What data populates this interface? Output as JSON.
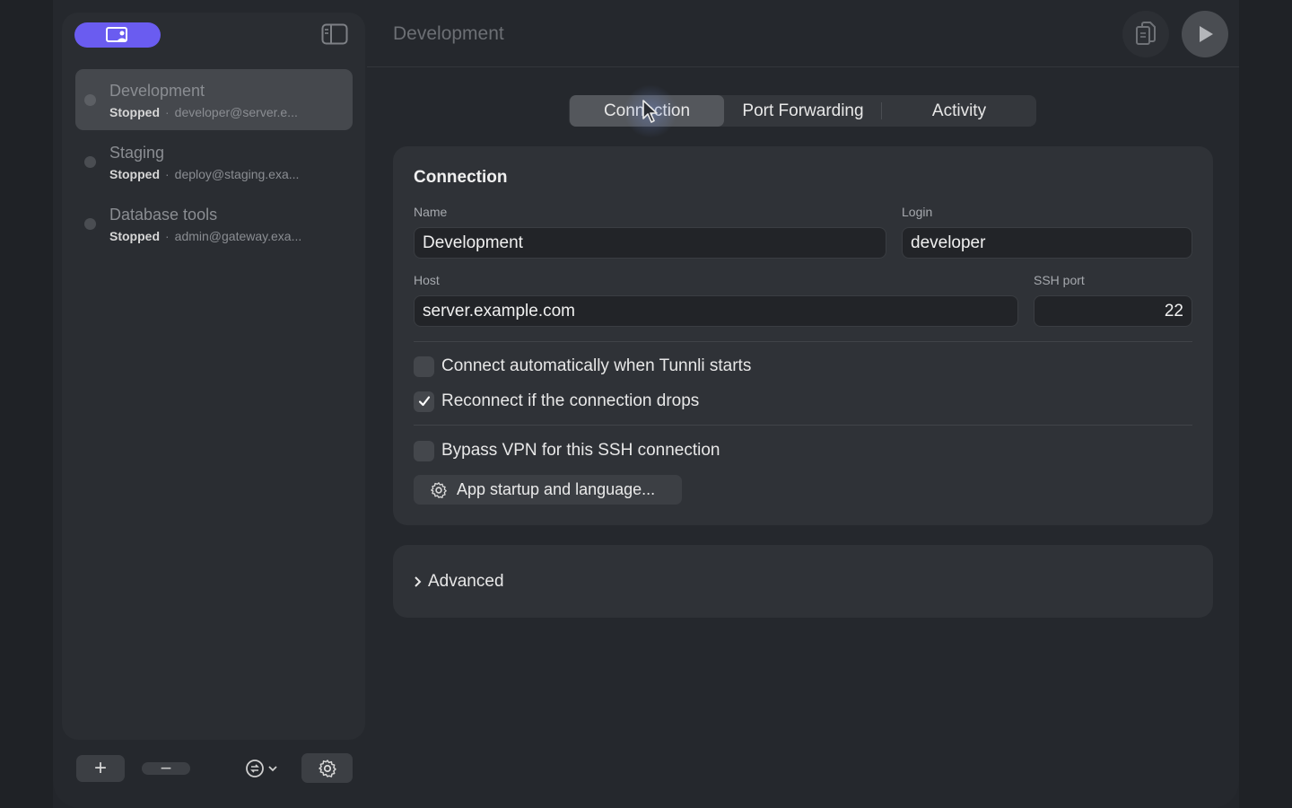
{
  "window": {
    "title": "Development"
  },
  "sidebar": {
    "items": [
      {
        "name": "Development",
        "status": "Stopped",
        "detail": "developer@server.e...",
        "selected": true
      },
      {
        "name": "Staging",
        "status": "Stopped",
        "detail": "deploy@staging.exa...",
        "selected": false
      },
      {
        "name": "Database tools",
        "status": "Stopped",
        "detail": "admin@gateway.exa...",
        "selected": false
      }
    ],
    "separator": "·",
    "footer": {
      "add": "+",
      "remove": "−"
    }
  },
  "tabs": {
    "connection": "Connection",
    "port_forwarding": "Port Forwarding",
    "activity": "Activity",
    "active": "Connection"
  },
  "connection": {
    "section_title": "Connection",
    "name_label": "Name",
    "name_value": "Development",
    "login_label": "Login",
    "login_value": "developer",
    "host_label": "Host",
    "host_value": "server.example.com",
    "port_label": "SSH port",
    "port_value": "22",
    "auto_connect_label": "Connect automatically when Tunnli starts",
    "auto_connect_checked": false,
    "reconnect_label": "Reconnect if the connection drops",
    "reconnect_checked": true,
    "bypass_vpn_label": "Bypass VPN for this SSH connection",
    "bypass_vpn_checked": false,
    "app_startup_button": "App startup and language..."
  },
  "advanced": {
    "label": "Advanced"
  },
  "colors": {
    "accent": "#6a5cf0",
    "background": "#25282d",
    "panel": "#2f3237"
  }
}
